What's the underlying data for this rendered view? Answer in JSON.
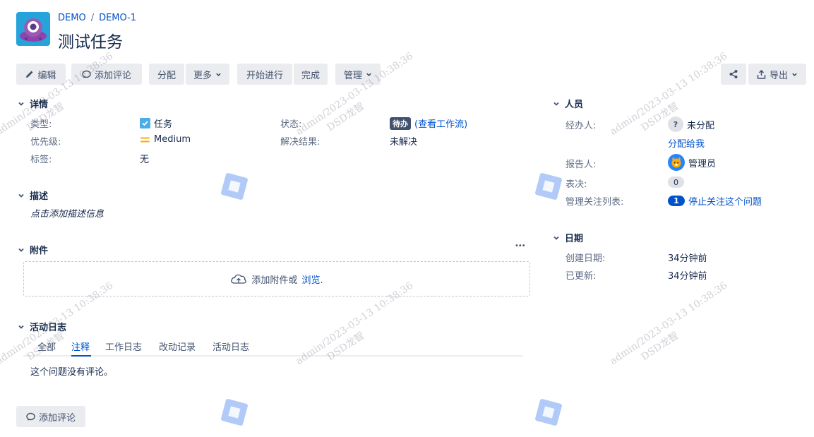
{
  "breadcrumb": {
    "project": "DEMO",
    "sep": "/",
    "issue": "DEMO-1"
  },
  "title": "测试任务",
  "toolbar": {
    "edit": "编辑",
    "comment": "添加评论",
    "assign": "分配",
    "more": "更多",
    "start": "开始进行",
    "done": "完成",
    "admin": "管理",
    "export": "导出"
  },
  "details": {
    "header": "详情",
    "type_label": "类型:",
    "type_value": "任务",
    "status_label": "状态:",
    "status_badge": "待办",
    "status_link": "(查看工作流)",
    "priority_label": "优先级:",
    "priority_value": "Medium",
    "resolution_label": "解决结果:",
    "resolution_value": "未解决",
    "labels_label": "标签:",
    "labels_value": "无"
  },
  "description": {
    "header": "描述",
    "placeholder": "点击添加描述信息"
  },
  "attachments": {
    "header": "附件",
    "more": "•••",
    "drop_text": "添加附件或",
    "browse": "浏览."
  },
  "activity": {
    "header": "活动日志",
    "tabs": [
      "全部",
      "注释",
      "工作日志",
      "改动记录",
      "活动日志"
    ],
    "active_tab": "注释",
    "empty": "这个问题没有评论。",
    "add_comment": "添加评论"
  },
  "people": {
    "header": "人员",
    "assignee_label": "经办人:",
    "assignee_value": "未分配",
    "assign_me": "分配给我",
    "reporter_label": "报告人:",
    "reporter_value": "管理员",
    "votes_label": "表决:",
    "votes_value": "0",
    "watchers_label": "管理关注列表:",
    "watchers_count": "1",
    "watchers_link": "停止关注这个问题"
  },
  "dates": {
    "header": "日期",
    "created_label": "创建日期:",
    "created_value": "34分钟前",
    "updated_label": "已更新:",
    "updated_value": "34分钟前"
  },
  "watermark": {
    "line1": "admin/2023-03-13 10:38:36",
    "line2": "DSD龙智"
  },
  "colors": {
    "link": "#0052cc",
    "status_badge": "#42526e",
    "priority": "#ffab00",
    "button_bg": "#ebecf0"
  }
}
